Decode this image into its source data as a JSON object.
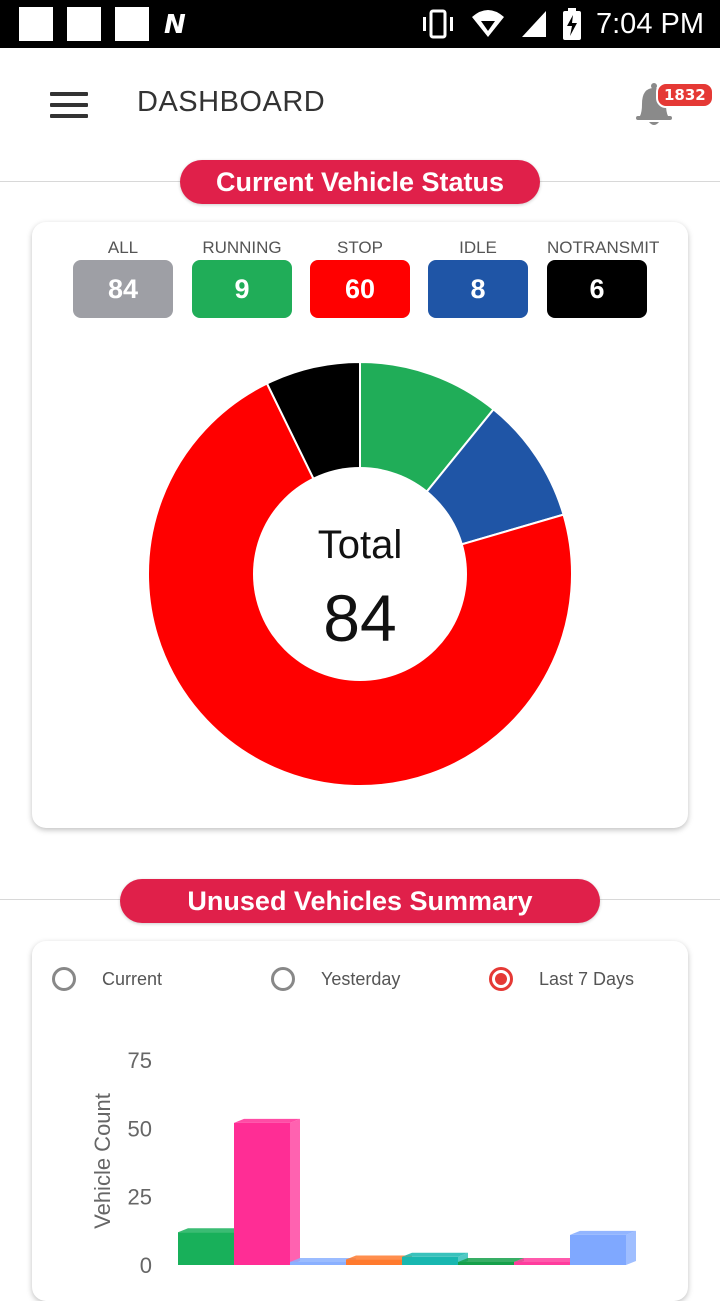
{
  "status_bar": {
    "time": "7:04 PM",
    "icons": [
      "notification-square-icon",
      "notification-square-icon",
      "notification-square-icon",
      "n-logo-icon",
      "vibrate-icon",
      "wifi-icon",
      "signal-icon",
      "battery-charging-icon"
    ],
    "n_glyph": "N"
  },
  "app_bar": {
    "title": "DASHBOARD",
    "notification_count": "1832"
  },
  "vehicle_status": {
    "heading": "Current Vehicle Status",
    "stats": [
      {
        "label": "ALL",
        "value": "84",
        "color": "#9e9fa5"
      },
      {
        "label": "RUNNING",
        "value": "9",
        "color": "#20ad58"
      },
      {
        "label": "STOP",
        "value": "60",
        "color": "#ff0000"
      },
      {
        "label": "IDLE",
        "value": "8",
        "color": "#1f55a6"
      },
      {
        "label": "NOTRANSMIT",
        "value": "6",
        "color": "#000000"
      }
    ],
    "donut_center_label": "Total",
    "donut_center_value": "84"
  },
  "unused_summary": {
    "heading": "Unused Vehicles Summary",
    "radios": [
      {
        "label": "Current",
        "checked": false
      },
      {
        "label": "Yesterday",
        "checked": false
      },
      {
        "label": "Last 7 Days",
        "checked": true
      }
    ]
  },
  "chart_data": [
    {
      "type": "pie",
      "title": "",
      "center_text": [
        "Total",
        "84"
      ],
      "slices": [
        {
          "name": "RUNNING",
          "value": 9,
          "color": "#20ad58"
        },
        {
          "name": "IDLE",
          "value": 8,
          "color": "#1f55a6"
        },
        {
          "name": "STOP",
          "value": 60,
          "color": "#ff0000"
        },
        {
          "name": "NOTRANSMIT",
          "value": 6,
          "color": "#000000"
        }
      ]
    },
    {
      "type": "bar",
      "title": "",
      "xlabel": "",
      "ylabel": "Vehicle Count",
      "ylim": [
        0,
        75
      ],
      "yticks": [
        0,
        25,
        50,
        75
      ],
      "values": [
        12,
        52,
        1,
        2,
        3,
        1,
        1,
        11
      ],
      "colors": [
        "#18b05a",
        "#ff2d95",
        "#8ab0ff",
        "#ff7a2e",
        "#18b7b0",
        "#15a04a",
        "#ff3c9d",
        "#7fa8ff"
      ]
    }
  ]
}
